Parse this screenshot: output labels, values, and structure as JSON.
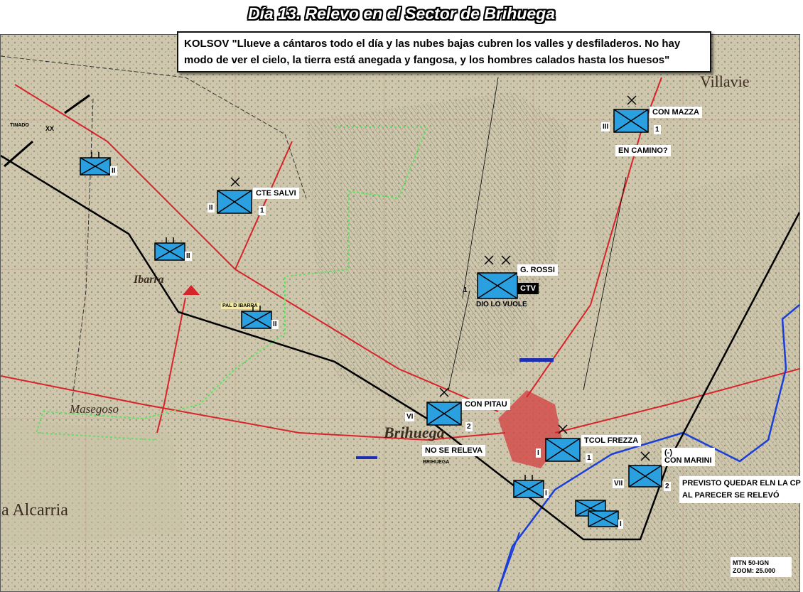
{
  "title": "Día 13. Relevo en el Sector de Brihuega",
  "quote": "KOLSOV \"Llueve a cántaros todo el día y las nubes bajas cubren los valles y desfiladeros. No hay modo de ver el cielo, la tierra está anegada y fangosa, y los hombres calados hasta los huesos\"",
  "units": {
    "mazza": {
      "name": "CON MAZZA",
      "echelon": "III",
      "num": "1",
      "note": "EN CAMINO?"
    },
    "salvi": {
      "name": "CTE SALVI",
      "echelon": "II",
      "num": "1"
    },
    "rossi": {
      "name": "G. ROSSI",
      "echelon": "1",
      "tag": "CTV",
      "motto": "DIO LO VUOLE"
    },
    "pitau": {
      "name": "CON PITAU",
      "echelon": "VI",
      "num": "2",
      "note": "NO SE RELEVA"
    },
    "frezza": {
      "name": "TCOL FREZZA",
      "echelon": "I",
      "num": "1"
    },
    "marini": {
      "name": "(-)\nCON MARINI",
      "echelon": "VII",
      "num": "2",
      "note": "PREVISTO QUEDAR ELN LA CP\nAL PARECER SE RELEVÓ"
    },
    "bn1": {
      "echelon": "II"
    },
    "bn2": {
      "echelon": "II"
    },
    "bn3": {
      "echelon": "II"
    },
    "bn4": {
      "echelon": "I"
    },
    "bn5": {
      "echelon": "I"
    }
  },
  "place_names": {
    "ibarra": "Ibarra",
    "masegoso": "Masegoso",
    "brihuega": "Brihuega",
    "alcarria": "a Alcarria",
    "villavie": "Villavie",
    "tinado": "TINADO",
    "xx": "XX",
    "pal_ibarra": "PAL D IBARRA",
    "brihuega_small": "BRIHUEGA"
  },
  "scale_note": {
    "line1": "MTN 50-IGN",
    "line2": "ZOOM: 25.000"
  },
  "colors": {
    "map_bg": "#cdc5ad",
    "unit_fill": "#2ba0e0",
    "road_red": "#d7242a",
    "front_line": "#000000",
    "boundary_green": "#5fe35f",
    "river_blue": "#1a3fd8"
  }
}
